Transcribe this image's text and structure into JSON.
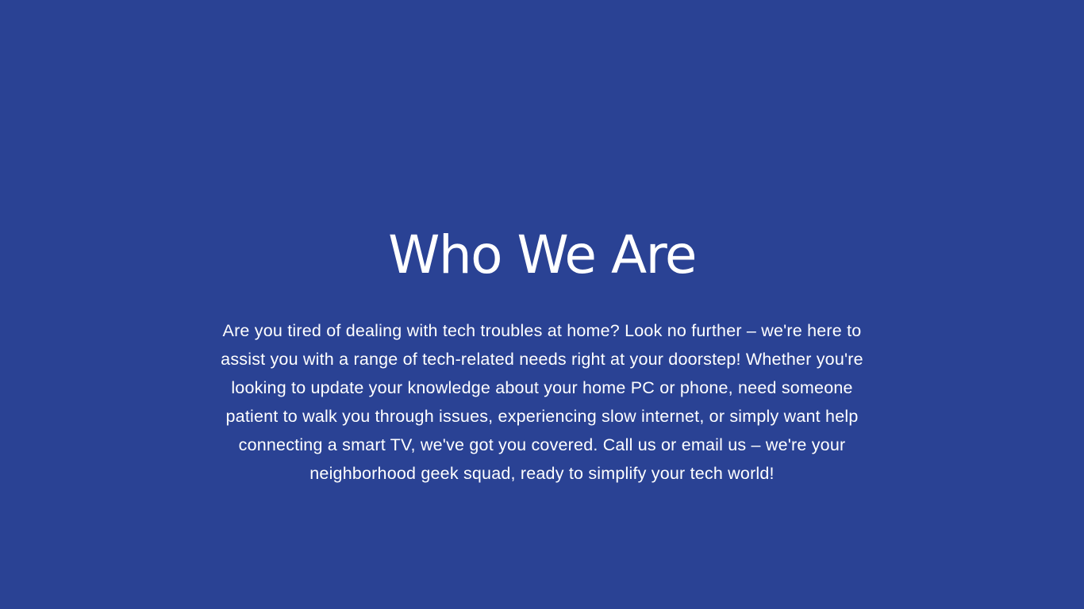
{
  "about": {
    "title": "Who We Are",
    "description": "Are you tired of dealing with tech troubles at home? Look no further – we're here to assist you with a range of tech-related needs right at your doorstep! Whether you're looking to update your knowledge about your home PC or phone, need someone patient to walk you through issues, experiencing slow internet, or simply want help connecting a smart TV, we've got you covered. Call us or email us – we're your neighborhood geek squad, ready to simplify your tech world!"
  },
  "colors": {
    "background": "#2a4294",
    "text": "#ffffff"
  }
}
